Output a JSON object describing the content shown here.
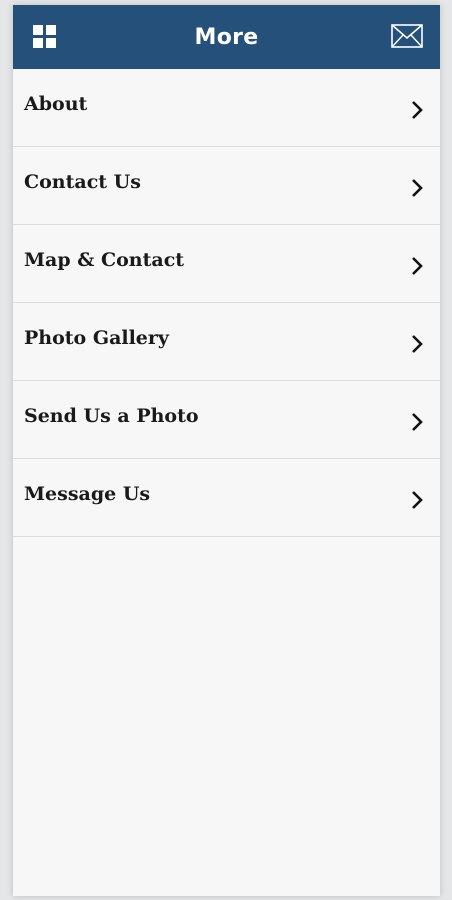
{
  "header": {
    "title": "More",
    "left_icon": "grid-icon",
    "right_icon": "mail-icon",
    "bar_color": "#24507a"
  },
  "menu": {
    "items": [
      {
        "label": "About"
      },
      {
        "label": "Contact Us"
      },
      {
        "label": "Map & Contact"
      },
      {
        "label": "Photo Gallery"
      },
      {
        "label": "Send Us a Photo"
      },
      {
        "label": "Message Us"
      }
    ],
    "chevron_icon": "chevron-right-icon"
  }
}
